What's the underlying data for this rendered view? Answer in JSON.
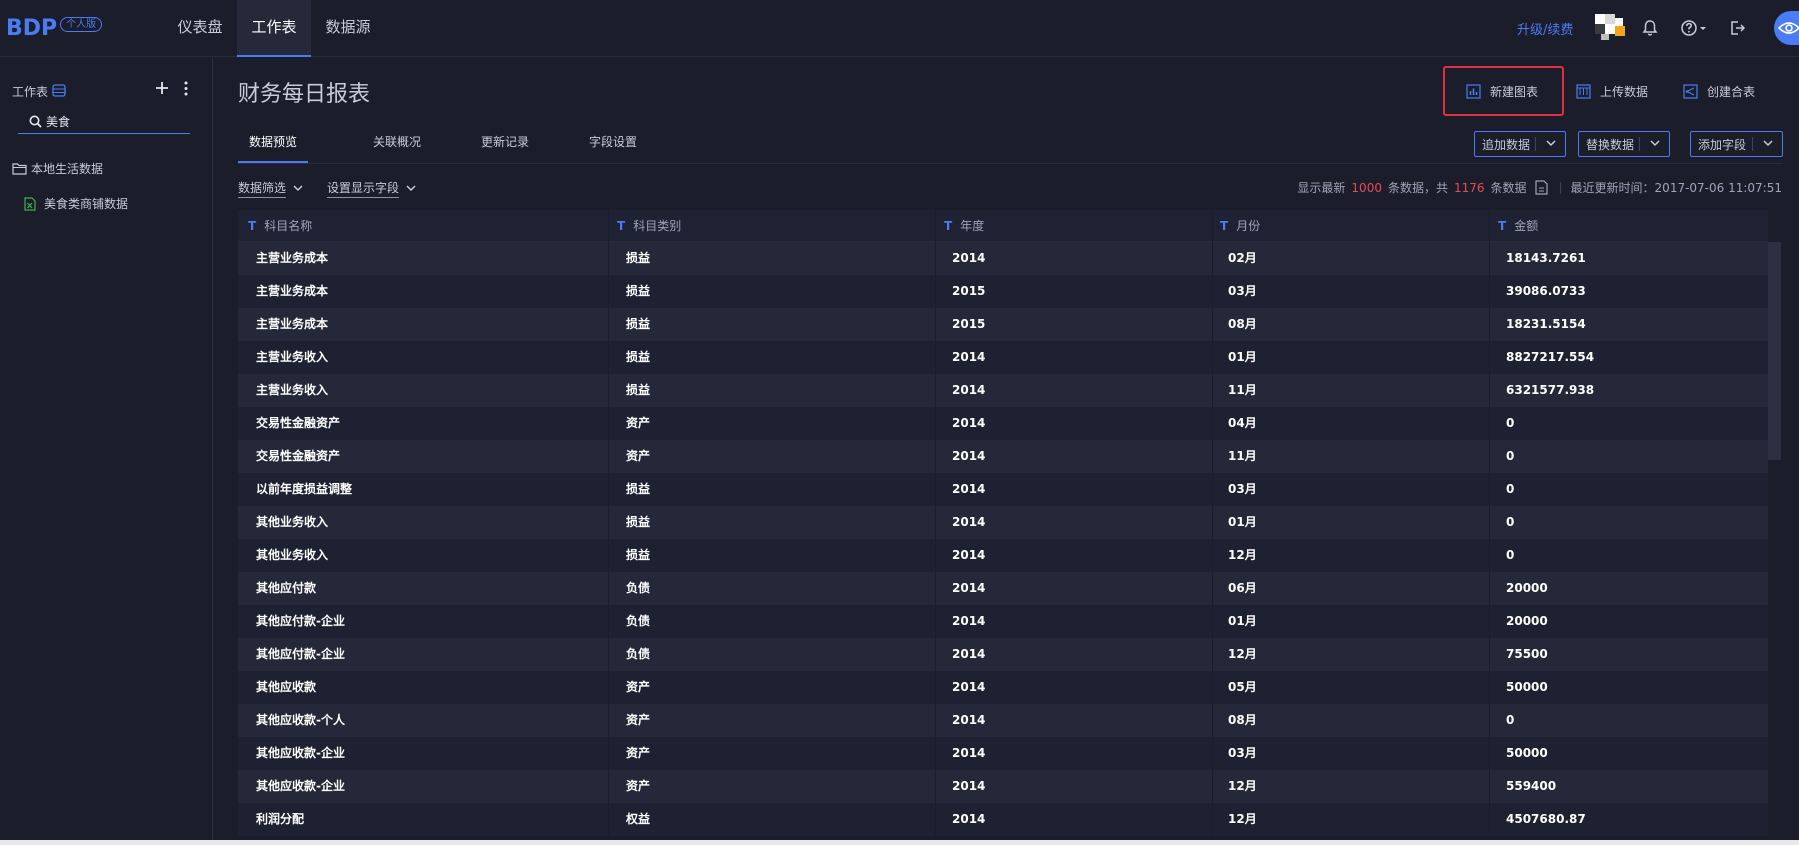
{
  "app": {
    "logo": "BDP",
    "edition_badge": "个人版"
  },
  "nav": {
    "items": [
      "仪表盘",
      "工作表",
      "数据源"
    ],
    "active": "工作表",
    "upgrade_label": "升级/续费"
  },
  "sidebar": {
    "title": "工作表",
    "search_value": "美食",
    "folder_label": "本地生活数据",
    "file_label": "美食类商铺数据"
  },
  "page": {
    "title": "财务每日报表",
    "actions": {
      "new_chart": "新建图表",
      "upload_data": "上传数据",
      "create_merge": "创建合表"
    },
    "tabs": [
      "数据预览",
      "关联概况",
      "更新记录",
      "字段设置"
    ],
    "active_tab": "数据预览",
    "dropdowns": {
      "append": "追加数据",
      "replace": "替换数据",
      "add_field": "添加字段"
    },
    "filters": {
      "data_filter": "数据筛选",
      "display_fields": "设置显示字段"
    },
    "stats": {
      "prefix": "显示最新",
      "shown": "1000",
      "mid": "条数据，共",
      "total": "1176",
      "suffix": "条数据",
      "last_updated": "最近更新时间：2017-07-06 11:07:51"
    }
  },
  "table": {
    "columns": [
      "科目名称",
      "科目类别",
      "年度",
      "月份",
      "金额"
    ],
    "rows": [
      [
        "主营业务成本",
        "损益",
        "2014",
        "02月",
        "18143.7261"
      ],
      [
        "主营业务成本",
        "损益",
        "2015",
        "03月",
        "39086.0733"
      ],
      [
        "主营业务成本",
        "损益",
        "2015",
        "08月",
        "18231.5154"
      ],
      [
        "主营业务收入",
        "损益",
        "2014",
        "01月",
        "8827217.554"
      ],
      [
        "主营业务收入",
        "损益",
        "2014",
        "11月",
        "6321577.938"
      ],
      [
        "交易性金融资产",
        "资产",
        "2014",
        "04月",
        "0"
      ],
      [
        "交易性金融资产",
        "资产",
        "2014",
        "11月",
        "0"
      ],
      [
        "以前年度损益调整",
        "损益",
        "2014",
        "03月",
        "0"
      ],
      [
        "其他业务收入",
        "损益",
        "2014",
        "01月",
        "0"
      ],
      [
        "其他业务收入",
        "损益",
        "2014",
        "12月",
        "0"
      ],
      [
        "其他应付款",
        "负债",
        "2014",
        "06月",
        "20000"
      ],
      [
        "其他应付款-企业",
        "负债",
        "2014",
        "01月",
        "20000"
      ],
      [
        "其他应付款-企业",
        "负债",
        "2014",
        "12月",
        "75500"
      ],
      [
        "其他应收款",
        "资产",
        "2014",
        "05月",
        "50000"
      ],
      [
        "其他应收款-个人",
        "资产",
        "2014",
        "08月",
        "0"
      ],
      [
        "其他应收款-企业",
        "资产",
        "2014",
        "03月",
        "50000"
      ],
      [
        "其他应收款-企业",
        "资产",
        "2014",
        "12月",
        "559400"
      ],
      [
        "利润分配",
        "权益",
        "2014",
        "12月",
        "4507680.87"
      ]
    ]
  },
  "colors": {
    "accent": "#4a7cf3",
    "highlight": "#e02f3e",
    "stat_number": "#e84a55"
  }
}
